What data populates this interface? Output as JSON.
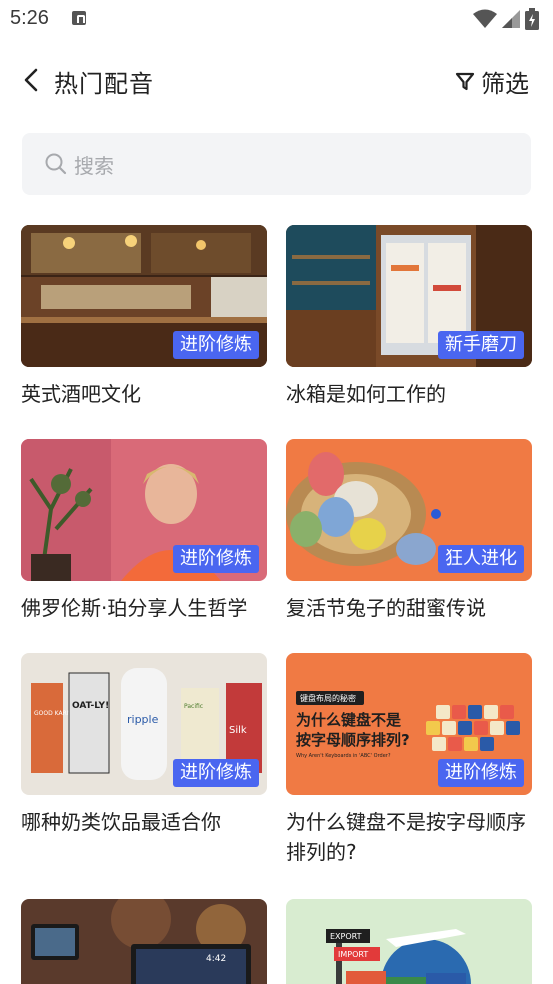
{
  "status": {
    "time": "5:26"
  },
  "header": {
    "title": "热门配音",
    "filter_label": "筛选"
  },
  "search": {
    "placeholder": "搜索"
  },
  "cards": [
    {
      "title": "英式酒吧文化",
      "badge": "进阶修炼"
    },
    {
      "title": "冰箱是如何工作的",
      "badge": "新手磨刀"
    },
    {
      "title": "佛罗伦斯·珀分享人生哲学",
      "badge": "进阶修炼"
    },
    {
      "title": "复活节兔子的甜蜜传说",
      "badge": "狂人进化"
    },
    {
      "title": "哪种奶类饮品最适合你",
      "badge": "进阶修炼"
    },
    {
      "title": "为什么键盘不是按字母顺序排列的?",
      "badge": "进阶修炼"
    }
  ],
  "thumb_text": {
    "milk_1": "GOOD KARMA",
    "milk_2": "OAT-LY!",
    "milk_3": "ripple",
    "milk_4": "Pacific",
    "milk_5": "Silk",
    "kb_tag": "键盘布局的秘密",
    "kb_line1": "为什么键盘不是",
    "kb_line2": "按字母顺序排列?",
    "kb_sub": "Why Aren't Keyboards in 'ABC' Order?",
    "export": "EXPORT",
    "import": "IMPORT",
    "time": "4:42"
  },
  "colors": {
    "accent": "#4a66f0",
    "search_bg": "#f3f4f6"
  }
}
